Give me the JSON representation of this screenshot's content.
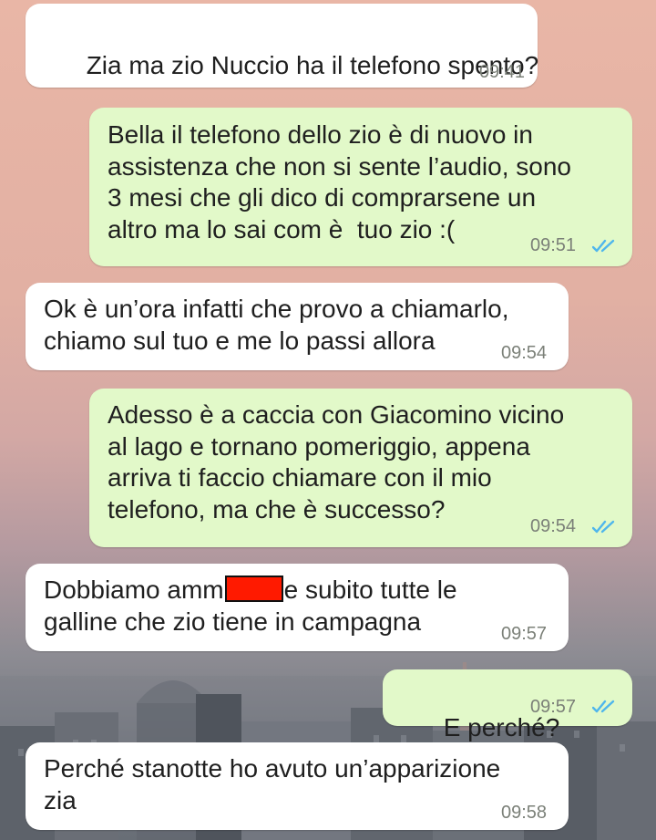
{
  "chat": {
    "messages": [
      {
        "direction": "incoming",
        "lines": [
          "Zia ma zio Nuccio ha il telefono spento?"
        ],
        "time": "09:41"
      },
      {
        "direction": "outgoing",
        "lines": [
          "Bella il telefono dello zio è di nuovo in",
          "assistenza che non si sente l’audio, sono",
          "3 mesi che gli dico di comprarsene un",
          "altro ma lo sai com è  tuo zio :("
        ],
        "time": "09:51",
        "status": "read"
      },
      {
        "direction": "incoming",
        "lines": [
          "Ok è un’ora infatti che provo a chiamarlo,",
          "chiamo sul tuo e me lo passi allora"
        ],
        "time": "09:54"
      },
      {
        "direction": "outgoing",
        "lines": [
          "Adesso è a caccia con Giacomino vicino",
          "al lago e tornano pomeriggio, appena",
          "arriva ti faccio chiamare con il mio",
          "telefono, ma che è successo?"
        ],
        "time": "09:54",
        "status": "read"
      },
      {
        "direction": "incoming",
        "lines": [
          "Dobbiamo amm",
          "e subito tutte le",
          "galline che zio tiene in campagna"
        ],
        "redacted": true,
        "time": "09:57"
      },
      {
        "direction": "outgoing",
        "lines": [
          "E perché?"
        ],
        "time": "09:57",
        "status": "read"
      },
      {
        "direction": "incoming",
        "lines": [
          "Perché stanotte ho avuto un’apparizione",
          "zia"
        ],
        "time": "09:58"
      }
    ]
  },
  "colors": {
    "incoming_bubble": "#ffffff",
    "outgoing_bubble": "#e2f9c9",
    "read_ticks": "#4fb6ec",
    "timestamp": "#7b8078",
    "redaction": "#ff1a00"
  },
  "icons": {
    "read_status": "double-check-icon"
  }
}
